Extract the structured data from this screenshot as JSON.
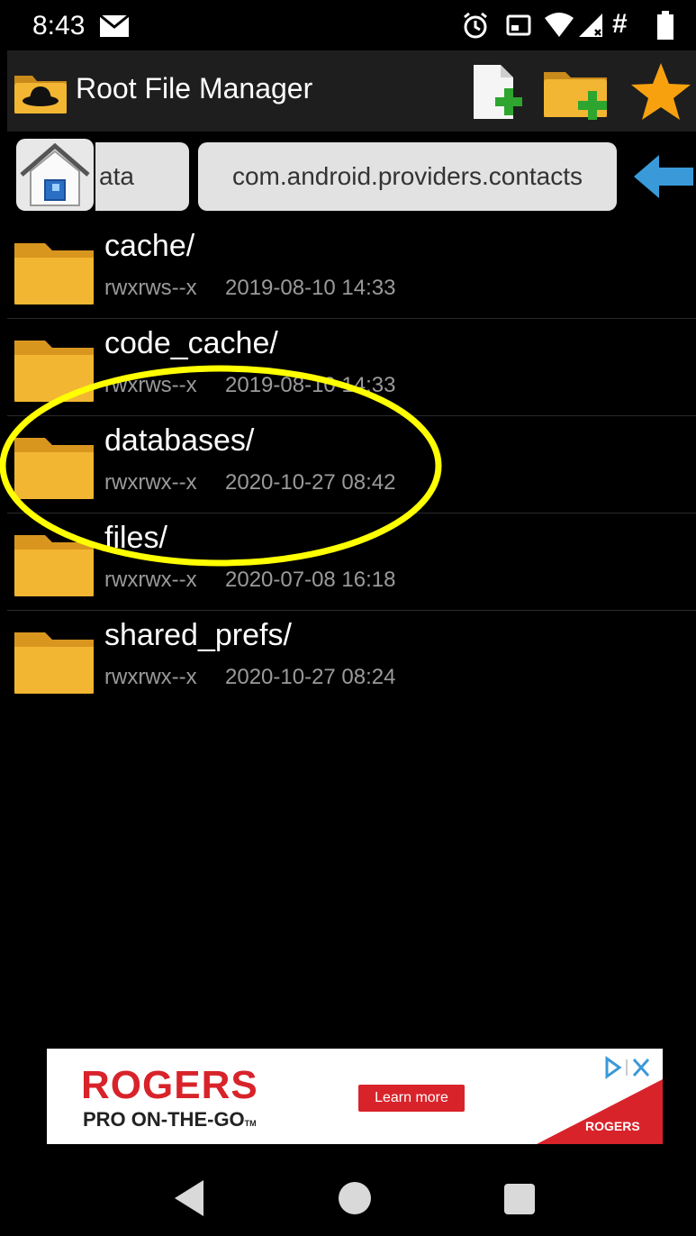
{
  "status_bar": {
    "time": "8:43",
    "icons": [
      "mail-icon",
      "alarm-icon",
      "cast-icon",
      "wifi-icon",
      "signal-icon",
      "hash-icon",
      "battery-icon"
    ],
    "hash": "#"
  },
  "app_bar": {
    "title": "Root File Manager",
    "actions": [
      "new-file-icon",
      "new-folder-icon",
      "star-icon"
    ]
  },
  "breadcrumb": {
    "items": [
      "ata",
      "com.android.providers.contacts"
    ]
  },
  "files": [
    {
      "name": "cache/",
      "permissions": "rwxrws--x",
      "date": "2019-08-10 14:33"
    },
    {
      "name": "code_cache/",
      "permissions": "rwxrws--x",
      "date": "2019-08-10 14:33"
    },
    {
      "name": "databases/",
      "permissions": "rwxrwx--x",
      "date": "2020-10-27 08:42"
    },
    {
      "name": "files/",
      "permissions": "rwxrwx--x",
      "date": "2020-07-08 16:18"
    },
    {
      "name": "shared_prefs/",
      "permissions": "rwxrwx--x",
      "date": "2020-10-27 08:24"
    }
  ],
  "ad": {
    "brand": "ROGERS",
    "tagline": "PRO ON-THE-GO",
    "tm": "TM",
    "cta": "Learn more",
    "brand_small": "ROGERS"
  },
  "colors": {
    "highlight": "#ffff00",
    "folder": "#f2b632",
    "accent_blue": "#3a9ad9",
    "ad_red": "#d8232a"
  }
}
